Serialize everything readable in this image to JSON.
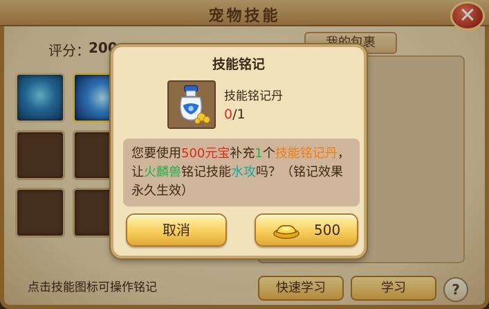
{
  "window": {
    "title": "宠物技能",
    "score_label": "评分：",
    "score_value": "200",
    "bag_tab": "我的包裹",
    "hint": "点击技能图标可操作铭记",
    "quick_learn": "快速学习",
    "learn": "学习",
    "help": "?",
    "close": "✕"
  },
  "dialog": {
    "title": "技能铭记",
    "item_name": "技能铭记丹",
    "item_count_current": "0",
    "item_count_total": "/1",
    "message": {
      "p1": "您要使用",
      "cost": "500元宝",
      "p2": "补充",
      "qty": "1",
      "p3": "个",
      "item": "技能铭记丹",
      "p4": "，让",
      "pet": "火麟兽",
      "p5": "铭记技能",
      "skill": "水攻",
      "p6": "吗？（铭记效果永久生效）"
    },
    "cancel_label": "取消",
    "confirm_label": "500",
    "confirm_icon": "gold-ingot-icon"
  },
  "colors": {
    "highlight_red": "#e02a17",
    "highlight_green": "#22b14c",
    "highlight_orange": "#f07d13",
    "highlight_teal": "#14a8a0"
  }
}
